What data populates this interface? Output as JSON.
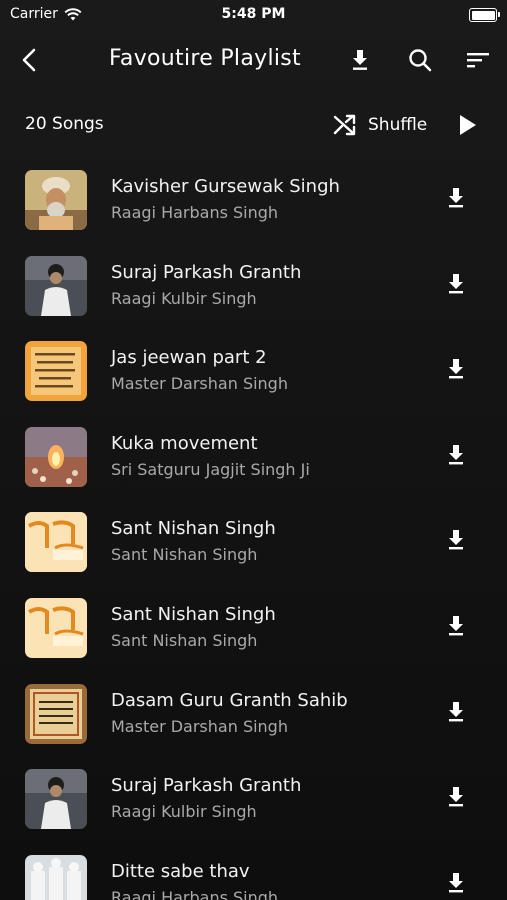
{
  "status_bar": {
    "carrier": "Carrier",
    "time": "5:48 PM"
  },
  "nav": {
    "title": "Favoutire Playlist"
  },
  "summary": {
    "song_count": "20 Songs",
    "shuffle_label": "Shuffle"
  },
  "icons": {
    "back": "chevron-left-icon",
    "download": "download-icon",
    "search": "search-icon",
    "sort": "sort-icon",
    "shuffle": "shuffle-icon",
    "play": "play-icon"
  },
  "songs": [
    {
      "title": "Kavisher Gursewak Singh",
      "artist": "Raagi Harbans Singh"
    },
    {
      "title": "Suraj Parkash Granth",
      "artist": "Raagi Kulbir Singh"
    },
    {
      "title": "Jas jeewan part 2",
      "artist": "Master Darshan Singh"
    },
    {
      "title": "Kuka movement",
      "artist": "Sri Satguru Jagjit Singh Ji"
    },
    {
      "title": "Sant Nishan Singh",
      "artist": "Sant Nishan Singh"
    },
    {
      "title": "Sant Nishan Singh",
      "artist": "Sant Nishan Singh"
    },
    {
      "title": "Dasam Guru Granth Sahib",
      "artist": "Master Darshan Singh"
    },
    {
      "title": "Suraj Parkash Granth",
      "artist": "Raagi Kulbir Singh"
    },
    {
      "title": "Ditte sabe thav",
      "artist": "Raagi Harbans Singh"
    }
  ],
  "colors": {
    "background": "#141414",
    "text_primary": "#f2f2f2",
    "text_secondary": "#a9a9a9"
  }
}
